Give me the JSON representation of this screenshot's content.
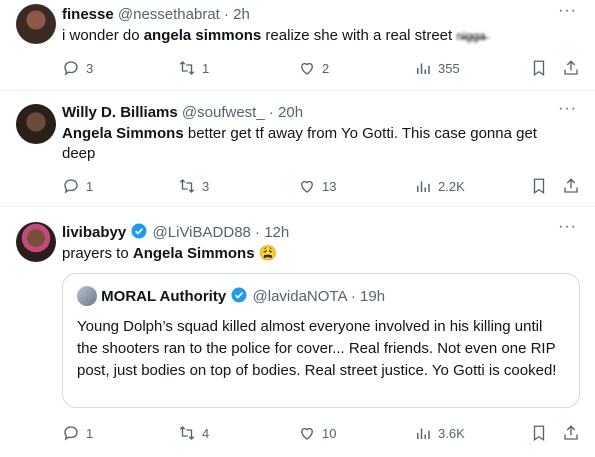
{
  "tweets": [
    {
      "name": "finesse",
      "handle": "@nessethabrat",
      "time": "· 2h",
      "text_pre": "i wonder do ",
      "text_bold": "angela simmons",
      "text_post": " realize she with a real street ",
      "text_censored": "n̶i̶g̶g̶a̶",
      "replies": "3",
      "retweets": "1",
      "likes": "2",
      "views": "355"
    },
    {
      "name": "Willy D. Billiams",
      "handle": "@soufwest_",
      "time": "· 20h",
      "text_bold": "Angela Simmons",
      "text_post": " better get tf away from Yo Gotti. This case gonna get deep",
      "replies": "1",
      "retweets": "3",
      "likes": "13",
      "views": "2.2K"
    },
    {
      "name": "livibabyy",
      "handle": "@LiViBADD88",
      "time": "· 12h",
      "text_pre": "prayers to ",
      "text_bold": "Angela Simmons",
      "emoji": "😩",
      "replies": "1",
      "retweets": "4",
      "likes": "10",
      "views": "3.6K",
      "quote": {
        "name": "MORAL Authority",
        "handle": "@lavidaNOTA",
        "time": "· 19h",
        "text": "Young Dolph’s squad killed almost everyone involved in his killing until the shooters ran to the police for cover... Real friends. Not even one RIP post, just bodies on top of bodies. Real street justice. Yo Gotti is cooked!"
      }
    }
  ],
  "colors": {
    "verified": "#1d9bf0",
    "muted": "#536471",
    "divider": "#eff3f4"
  },
  "icons": [
    "reply-icon",
    "retweet-icon",
    "like-icon",
    "views-icon",
    "bookmark-icon",
    "share-icon",
    "more-icon",
    "verified-icon"
  ]
}
